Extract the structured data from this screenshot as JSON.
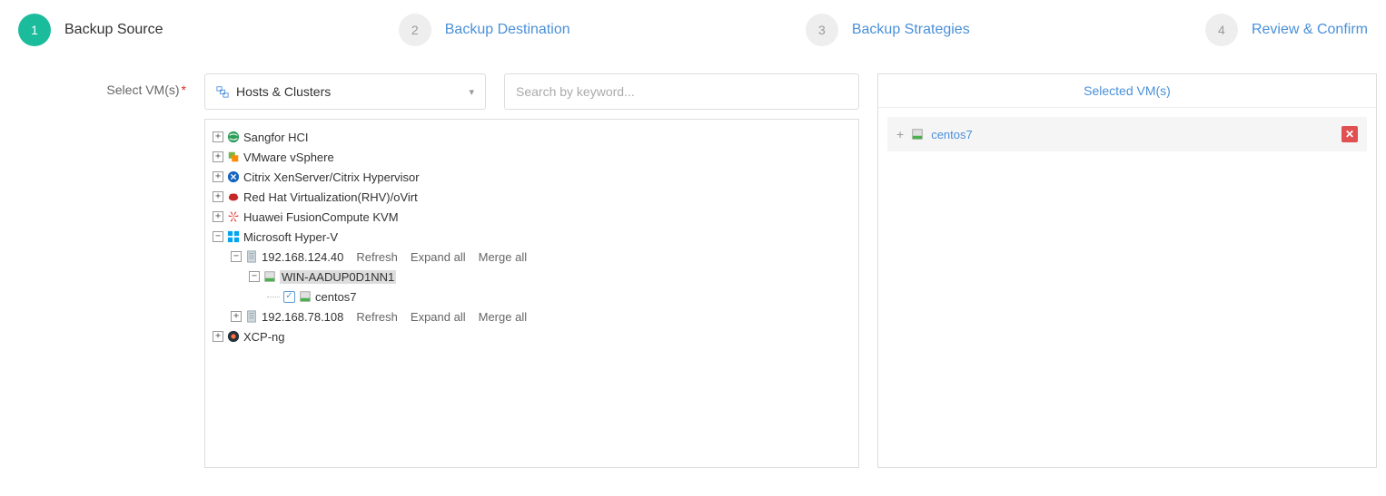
{
  "wizard": {
    "steps": [
      {
        "num": "1",
        "label": "Backup Source",
        "state": "active"
      },
      {
        "num": "2",
        "label": "Backup Destination",
        "state": "inactive"
      },
      {
        "num": "3",
        "label": "Backup Strategies",
        "state": "inactive"
      },
      {
        "num": "4",
        "label": "Review & Confirm",
        "state": "inactive"
      }
    ]
  },
  "side_label": "Select VM(s)",
  "dropdown": {
    "label": "Hosts & Clusters"
  },
  "search": {
    "placeholder": "Search by keyword..."
  },
  "tree": {
    "nodes": [
      {
        "label": "Sangfor HCI"
      },
      {
        "label": "VMware vSphere"
      },
      {
        "label": "Citrix XenServer/Citrix Hypervisor"
      },
      {
        "label": "Red Hat Virtualization(RHV)/oVirt"
      },
      {
        "label": "Huawei FusionCompute KVM"
      },
      {
        "label": "Microsoft Hyper-V"
      }
    ],
    "hyperv_host1": {
      "label": "192.168.124.40",
      "actions": {
        "refresh": "Refresh",
        "expand": "Expand all",
        "merge": "Merge all"
      },
      "child": {
        "label": "WIN-AADUP0D1NN1",
        "vm": {
          "label": "centos7"
        }
      }
    },
    "hyperv_host2": {
      "label": "192.168.78.108",
      "actions": {
        "refresh": "Refresh",
        "expand": "Expand all",
        "merge": "Merge all"
      }
    },
    "xcpng": {
      "label": "XCP-ng"
    }
  },
  "selected": {
    "title": "Selected VM(s)",
    "items": [
      {
        "label": "centos7"
      }
    ]
  }
}
